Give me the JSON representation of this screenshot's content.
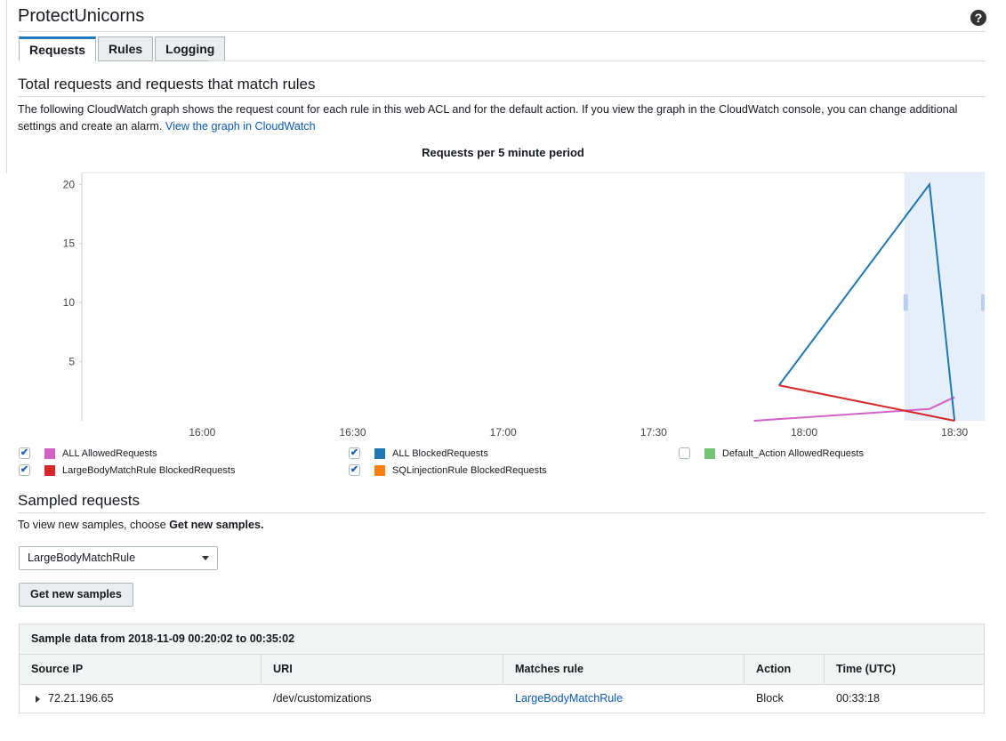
{
  "header": {
    "title": "ProtectUnicorns",
    "help_icon": "?"
  },
  "tabs": [
    {
      "label": "Requests",
      "active": true
    },
    {
      "label": "Rules",
      "active": false
    },
    {
      "label": "Logging",
      "active": false
    }
  ],
  "requests_section": {
    "title": "Total requests and requests that match rules",
    "description": "The following CloudWatch graph shows the request count for each rule in this web ACL and for the default action. If you view the graph in the CloudWatch console, you can change additional settings and create an alarm.",
    "link": "View the graph in CloudWatch"
  },
  "chart_data": {
    "type": "line",
    "title": "Requests per 5 minute period",
    "x_ticks": [
      "16:00",
      "16:30",
      "17:00",
      "17:30",
      "18:00",
      "18:30"
    ],
    "y_ticks": [
      5,
      10,
      15,
      20
    ],
    "ylim": [
      0,
      20
    ],
    "series": [
      {
        "name": "ALL AllowedRequests",
        "color": "#d262c6",
        "checked": true,
        "x": [
          "17:50",
          "18:25",
          "18:30"
        ],
        "y": [
          0,
          1,
          2
        ]
      },
      {
        "name": "ALL BlockedRequests",
        "color": "#1f77b4",
        "checked": true,
        "x": [
          "17:55",
          "18:25",
          "18:30"
        ],
        "y": [
          3,
          20,
          0
        ]
      },
      {
        "name": "Default_Action AllowedRequests",
        "color": "#74c476",
        "checked": false,
        "x": [],
        "y": []
      },
      {
        "name": "LargeBodyMatchRule BlockedRequests",
        "color": "#d62728",
        "checked": true,
        "x": [
          "17:55",
          "18:30"
        ],
        "y": [
          3,
          0
        ]
      },
      {
        "name": "SQLinjectionRule BlockedRequests",
        "color": "#ff7f0e",
        "checked": true,
        "x": [],
        "y": []
      }
    ]
  },
  "sampled": {
    "title": "Sampled requests",
    "hint_prefix": "To view new samples, choose ",
    "hint_bold": "Get new samples.",
    "selected_rule": "LargeBodyMatchRule",
    "button": "Get new samples",
    "table": {
      "caption": "Sample data from 2018-11-09 00:20:02 to 00:35:02",
      "columns": [
        "Source IP",
        "URI",
        "Matches rule",
        "Action",
        "Time (UTC)"
      ],
      "rows": [
        [
          "72.21.196.65",
          "/dev/customizations",
          "LargeBodyMatchRule",
          "Block",
          "00:33:18"
        ]
      ]
    }
  }
}
